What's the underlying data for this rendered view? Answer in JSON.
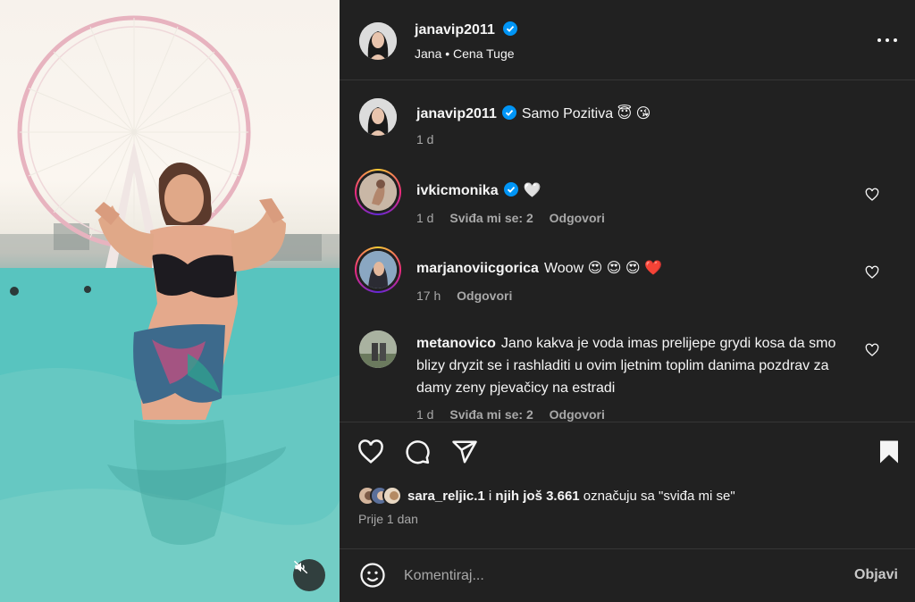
{
  "post": {
    "username": "janavip2011",
    "subtitle": "Jana • Cena Tuge",
    "caption": "Samo Pozitiva 😇 😘",
    "caption_time": "1 d"
  },
  "comments": [
    {
      "username": "ivkicmonika",
      "verified": true,
      "text": "🤍",
      "time": "1 d",
      "likes": "Sviđa mi se: 2",
      "reply": "Odgovori"
    },
    {
      "username": "marjanoviicgorica",
      "verified": false,
      "text": "Woow 😍 😍 😍 ❤️",
      "time": "17 h",
      "reply": "Odgovori"
    },
    {
      "username": "metanovico",
      "verified": false,
      "text": "Jano kakva je voda imas prelijepe grydi kosa da smo blizy dryzit se i rashladiti u ovim ljetnim toplim danima pozdrav za damy zeny pjevačicy na estradi",
      "time": "1 d",
      "likes": "Sviđa mi se: 2",
      "reply": "Odgovori"
    }
  ],
  "likes": {
    "first_user": "sara_reljic.1",
    "mid_text": " i ",
    "others": "njih još 3.661",
    "suffix": " označuju sa \"sviđa mi se\""
  },
  "posted_time": "Prije 1 dan",
  "compose": {
    "placeholder": "Komentiraj...",
    "post_label": "Objavi"
  },
  "colors": {
    "background": "#212121",
    "text": "#f5f5f5",
    "secondary_text": "#a8a8a8",
    "verified_blue": "#0095f6",
    "divider": "#363636"
  },
  "icons": {
    "more": "more-horizontal-icon",
    "verified": "verified-badge-icon",
    "like": "heart-icon",
    "comment": "comment-bubble-icon",
    "share": "paper-plane-icon",
    "save": "bookmark-icon",
    "emoji": "smiley-icon",
    "mute": "speaker-muted-icon"
  }
}
